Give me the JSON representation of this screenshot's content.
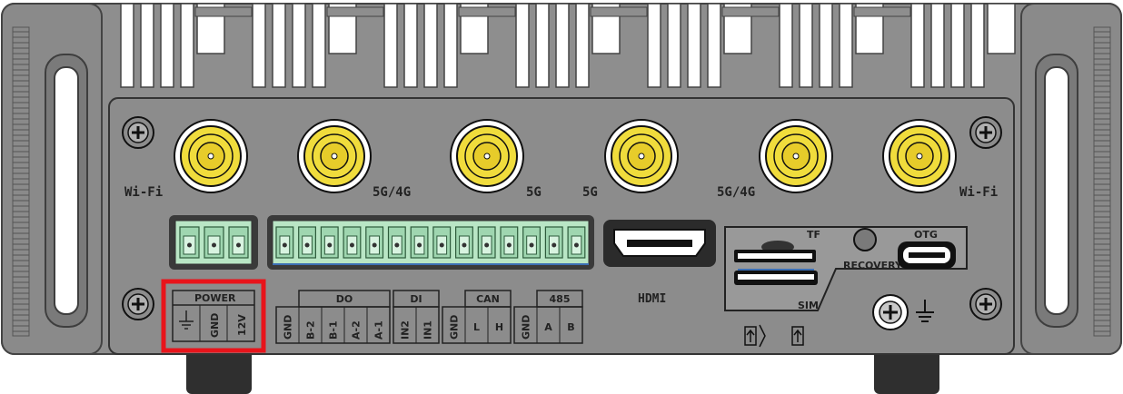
{
  "antenna_labels": {
    "left_wifi": "Wi-Fi",
    "ant2": "5G/4G",
    "ant3": "5G",
    "ant4": "5G",
    "ant5": "5G/4G",
    "right_wifi": "Wi-Fi"
  },
  "ports": {
    "hdmi": "HDMI",
    "tf": "TF",
    "sim": "SIM",
    "recovery": "RECOVERY",
    "otg": "OTG"
  },
  "terminal_block": {
    "power": {
      "title": "POWER",
      "pins": [
        "GND",
        "12V"
      ]
    },
    "do": {
      "title": "DO",
      "pins": [
        "GND",
        "B-2",
        "B-1",
        "A-2",
        "A-1"
      ]
    },
    "di": {
      "title": "DI",
      "pins": [
        "IN2",
        "IN1"
      ]
    },
    "can": {
      "title": "CAN",
      "pins": [
        "GND",
        "L",
        "H"
      ]
    },
    "rs485": {
      "title": "485",
      "pins": [
        "GND",
        "A",
        "B"
      ]
    }
  },
  "colors": {
    "highlight": "#e8141b",
    "connector_gold": "#f0dc3c",
    "terminal_green": "#b9e6c5",
    "panel_gray": "#8c8c8c"
  }
}
